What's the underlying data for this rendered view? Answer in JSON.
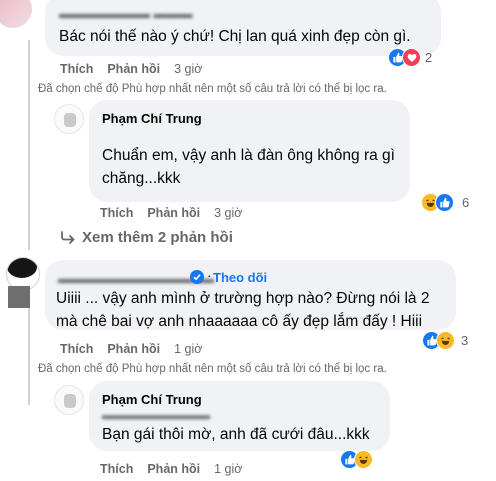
{
  "comment1": {
    "text": "Bác nói thế nào ý chứ! Chị lan quá xinh đẹp còn gì.",
    "actions": {
      "like": "Thích",
      "reply": "Phản hồi",
      "time": "3 giờ"
    },
    "reaction_count": "2"
  },
  "filter_notice_1": "Đã chọn chế độ Phù hợp nhất nên một số câu trả lời có thể bị lọc ra.",
  "reply1": {
    "author": "Phạm Chí Trung",
    "lines": [
      "Chuẩn em, vậy anh là đàn ông không ra gì",
      "chăng...kkk"
    ],
    "actions": {
      "like": "Thích",
      "reply": "Phản hồi",
      "time": "3 giờ"
    },
    "reaction_count": "6"
  },
  "view_more": "Xem thêm 2 phản hồi",
  "comment2": {
    "follow": "Theo dõi",
    "lines": [
      "Uiiii ... vậy anh mình ở trường hợp nào? Đừng nói là 2",
      "mà chê bai vợ anh nhaaaaaa cô ấy đẹp lắm đấy ! Hiii"
    ],
    "actions": {
      "like": "Thích",
      "reply": "Phản hồi",
      "time": "1 giờ"
    },
    "reaction_count": "3"
  },
  "filter_notice_2": "Đã chọn chế độ Phù hợp nhất nên một số câu trả lời có thể bị lọc ra.",
  "reply2": {
    "author": "Phạm Chí Trung",
    "text": "Bạn gái thôi mờ, anh đã cưới đâu...kkk",
    "actions": {
      "like": "Thích",
      "reply": "Phản hồi",
      "time": "1 giờ"
    }
  },
  "colors": {
    "like_blue": "#1877f2",
    "love_red": "#f33e58",
    "haha_yellow": "#f7b928",
    "bubble_gray": "#f0f2f5",
    "meta_gray": "#65676b"
  }
}
